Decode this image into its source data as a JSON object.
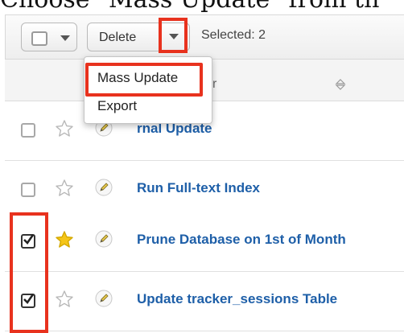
{
  "caption": "Choose \"Mass Update\" from th",
  "toolbar": {
    "delete_label": "Delete",
    "selected_text": "Selected: 2"
  },
  "header": {
    "column_label": "r"
  },
  "menu": {
    "items": [
      {
        "label": "Mass Update"
      },
      {
        "label": "Export"
      }
    ]
  },
  "rows": [
    {
      "name": "rnal Update",
      "checked": false,
      "starred": false
    },
    {
      "name": "Run Full-text Index",
      "checked": false,
      "starred": false
    },
    {
      "name": "Prune Database on 1st of Month",
      "checked": true,
      "starred": true
    },
    {
      "name": "Update tracker_sessions Table",
      "checked": true,
      "starred": false
    }
  ],
  "colors": {
    "link": "#1e5fa8",
    "highlight": "#e8321e",
    "star_filled": "#f5c518"
  },
  "icons": {
    "star": "star-icon",
    "pencil": "pencil-icon",
    "sort": "sort-icon",
    "caret": "chevron-down-icon"
  }
}
